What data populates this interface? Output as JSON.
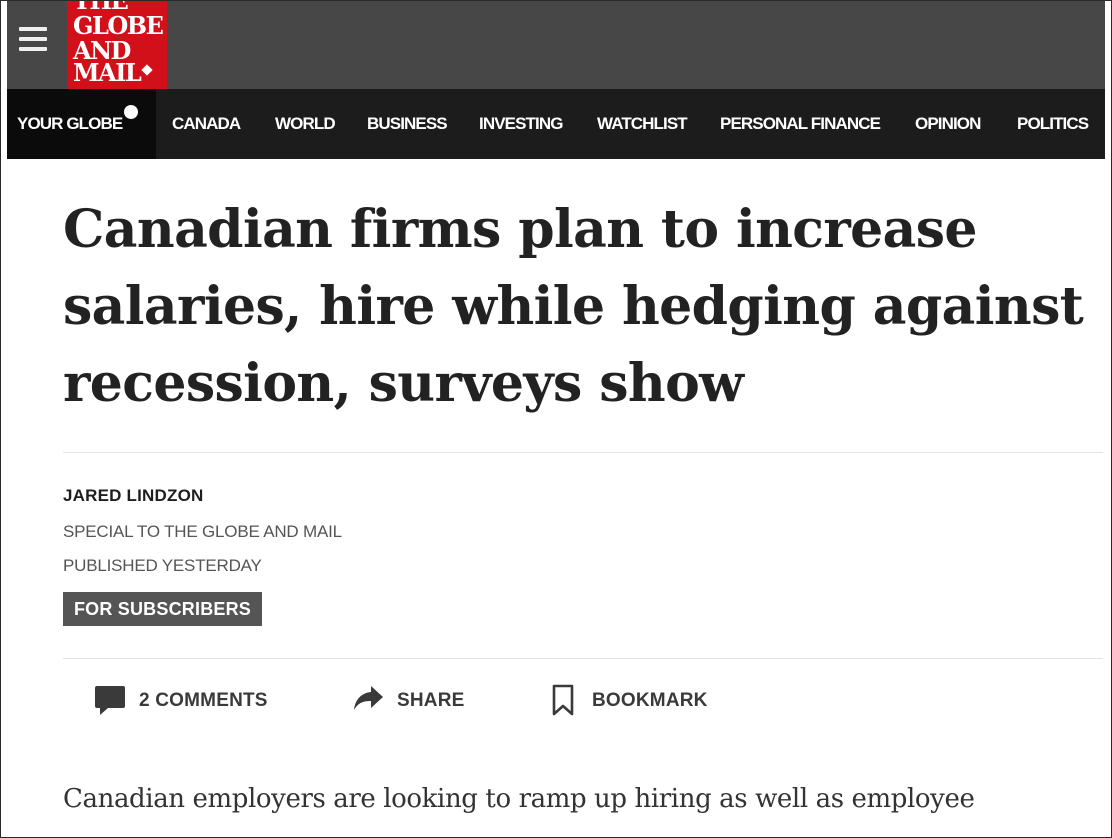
{
  "masthead": {
    "logo_lines": [
      "THE",
      "GLOBE",
      "AND",
      "MAIL"
    ],
    "brand_color": "#d1101a",
    "menu_icon": "hamburger-menu-icon"
  },
  "nav": {
    "items": [
      {
        "label": "YOUR GLOBE"
      },
      {
        "label": "CANADA"
      },
      {
        "label": "WORLD"
      },
      {
        "label": "BUSINESS"
      },
      {
        "label": "INVESTING"
      },
      {
        "label": "WATCHLIST"
      },
      {
        "label": "PERSONAL FINANCE"
      },
      {
        "label": "OPINION"
      },
      {
        "label": "POLITICS"
      }
    ]
  },
  "article": {
    "headline": "Canadian firms plan to increase salaries, hire while hedging against recession, surveys show",
    "author": "JARED LINDZON",
    "affiliation": "SPECIAL TO THE GLOBE AND MAIL",
    "published": "PUBLISHED YESTERDAY",
    "badge": "FOR SUBSCRIBERS",
    "lede": "Canadian employers are looking to ramp up hiring as well as employee"
  },
  "actions": {
    "comments_label": "2 COMMENTS",
    "share_label": "SHARE",
    "bookmark_label": "BOOKMARK"
  }
}
